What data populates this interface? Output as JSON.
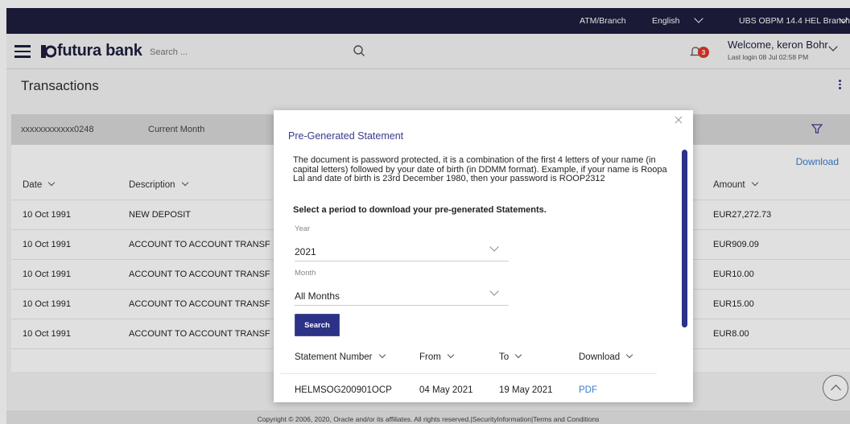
{
  "topbar": {
    "atm_branch": "ATM/Branch",
    "language": "English",
    "branch": "UBS OBPM 14.4 HEL Branch"
  },
  "header": {
    "logo_text": "futura bank",
    "search_placeholder": "Search ...",
    "notification_count": "3",
    "welcome": "Welcome, keron Bohr",
    "last_login": "Last login 08 Jul 02:58 PM"
  },
  "page": {
    "title": "Transactions"
  },
  "filter": {
    "account": "xxxxxxxxxxxx0248",
    "period": "Current Month"
  },
  "table": {
    "download_label": "Download",
    "columns": [
      "Date",
      "Description",
      "Amount"
    ],
    "rows": [
      {
        "date": "10 Oct 1991",
        "description": "NEW DEPOSIT",
        "amount": "EUR27,272.73"
      },
      {
        "date": "10 Oct 1991",
        "description": "ACCOUNT TO ACCOUNT TRANSF",
        "amount": "EUR909.09"
      },
      {
        "date": "10 Oct 1991",
        "description": "ACCOUNT TO ACCOUNT TRANSF",
        "amount": "EUR10.00"
      },
      {
        "date": "10 Oct 1991",
        "description": "ACCOUNT TO ACCOUNT TRANSF",
        "amount": "EUR15.00"
      },
      {
        "date": "10 Oct 1991",
        "description": "ACCOUNT TO ACCOUNT TRANSF",
        "amount": "EUR8.00"
      }
    ]
  },
  "modal": {
    "title": "Pre-Generated Statement",
    "notice": "The document is password protected, it is a combination of the first 4 letters of your name (in capital letters) followed by your date of birth (in DDMM format). Example, if your name is Roopa Lal and date of birth is 23rd December 1980, then your password is ROOP2312",
    "period_label": "Select a period to download your pre-generated Statements.",
    "year_label": "Year",
    "year_value": "2021",
    "month_label": "Month",
    "month_value": "All Months",
    "search_label": "Search",
    "statement_columns": [
      "Statement Number",
      "From",
      "To",
      "Download"
    ],
    "statement_rows": [
      {
        "number": "HELMSOG200901OCP",
        "from": "04 May 2021",
        "to": "19 May 2021",
        "download": "PDF"
      }
    ]
  },
  "footer": {
    "text": "Copyright © 2006, 2020, Oracle and/or its affiliates. All rights reserved.|SecurityInformation|Terms and Conditions"
  },
  "colors": {
    "topbar": "#1e1e3f",
    "primary": "#2c3286",
    "link": "#3a7ecb",
    "badge": "#e03a2b"
  }
}
